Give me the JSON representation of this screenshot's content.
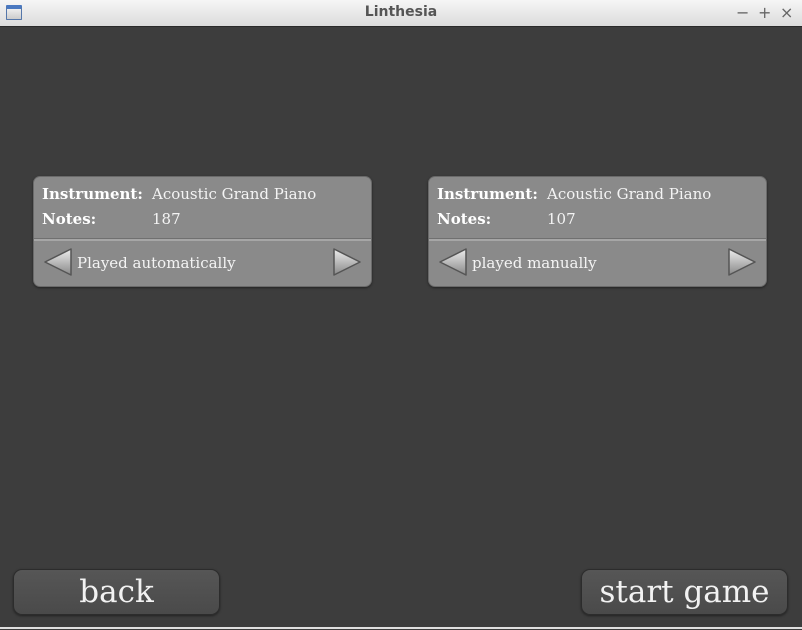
{
  "window": {
    "title": "Linthesia",
    "minimize": "−",
    "maximize": "+",
    "close": "×"
  },
  "tracks": [
    {
      "instrument_label": "Instrument:",
      "instrument": "Acoustic Grand Piano",
      "notes_label": "Notes:",
      "notes": "187",
      "mode": "Played automatically"
    },
    {
      "instrument_label": "Instrument:",
      "instrument": "Acoustic Grand Piano",
      "notes_label": "Notes:",
      "notes": "107",
      "mode": "played manually"
    }
  ],
  "buttons": {
    "back": "back",
    "start": "start game"
  }
}
